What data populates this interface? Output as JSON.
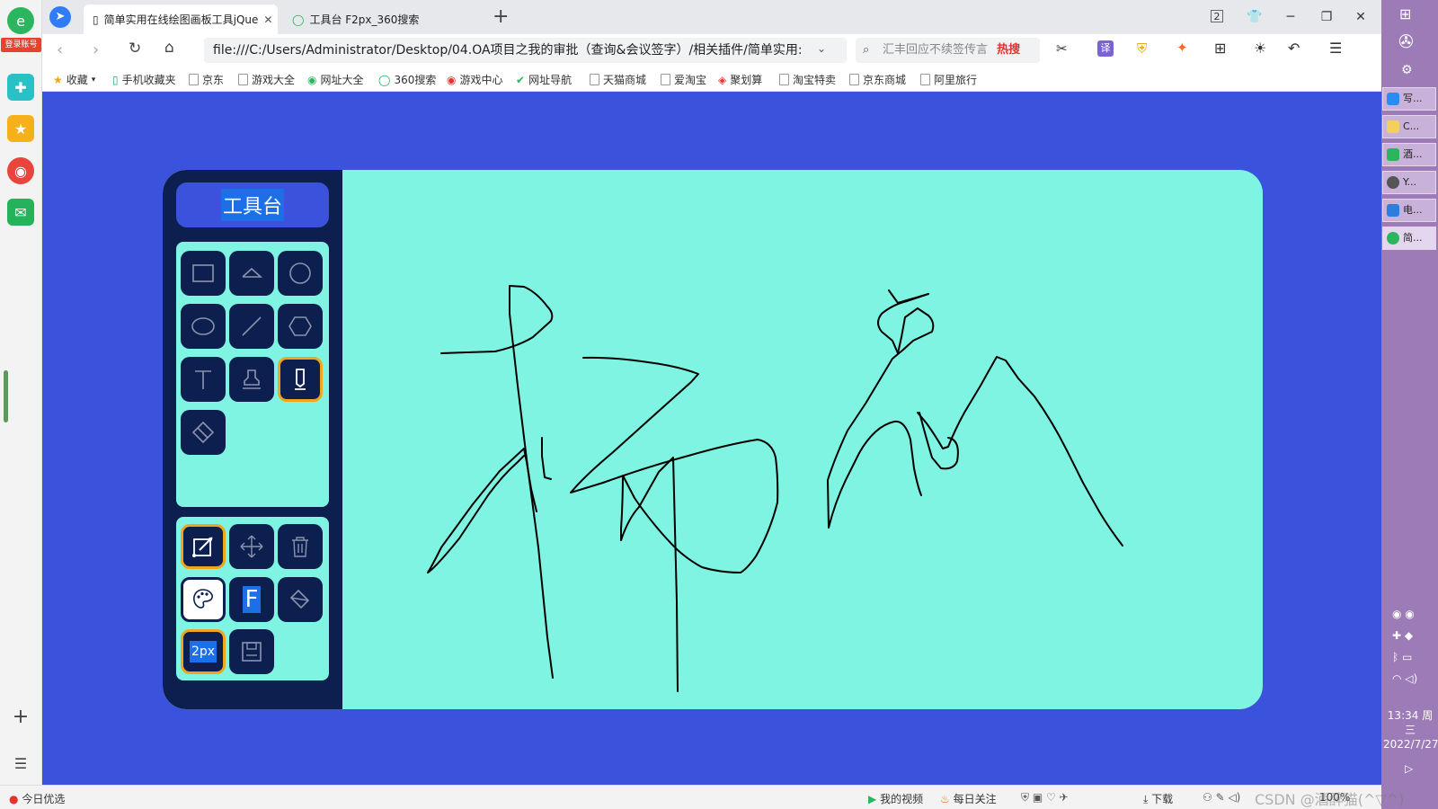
{
  "browser": {
    "tabs": [
      {
        "label": "简单实用在线绘图画板工具jQue",
        "active": true
      },
      {
        "label": "工具台 F2px_360搜索",
        "active": false
      }
    ],
    "tab_counter": "2",
    "url": "file:///C:/Users/Administrator/Desktop/04.OA项目之我的审批（查询&会议签字）/相关插件/简单实用:",
    "search_placeholder": "汇丰回应不续签传言",
    "search_hot": "热搜",
    "login_badge": "登录账号",
    "bookmarks": [
      "收藏",
      "手机收藏夹",
      "京东",
      "游戏大全",
      "网址大全",
      "360搜索",
      "游戏中心",
      "网址导航",
      "天猫商城",
      "爱淘宝",
      "聚划算",
      "淘宝特卖",
      "京东商城",
      "阿里旅行"
    ]
  },
  "status_bar": {
    "left": "今日优选",
    "items": [
      "我的视频",
      "每日关注",
      "下载"
    ],
    "zoom": "100%",
    "watermark": "CSDN @酒醉猫(^▽^)"
  },
  "taskbar": {
    "tasks": [
      "写...",
      "C...",
      "酒...",
      "Y...",
      "电...",
      "简..."
    ],
    "time": "13:34 周三",
    "date": "2022/7/27"
  },
  "toolpanel": {
    "title": "工具台",
    "shape_tools": [
      {
        "name": "rectangle",
        "icon": "rectangle-icon",
        "selected": false
      },
      {
        "name": "triangle",
        "icon": "triangle-icon",
        "selected": false
      },
      {
        "name": "circle",
        "icon": "circle-icon",
        "selected": false
      },
      {
        "name": "ellipse",
        "icon": "ellipse-icon",
        "selected": false
      },
      {
        "name": "line",
        "icon": "line-icon",
        "selected": false
      },
      {
        "name": "hexagon",
        "icon": "hexagon-icon",
        "selected": false
      },
      {
        "name": "text",
        "icon": "text-icon",
        "selected": false
      },
      {
        "name": "stamp",
        "icon": "stamp-icon",
        "selected": false
      },
      {
        "name": "pen",
        "icon": "pen-icon",
        "selected": true
      },
      {
        "name": "eraser",
        "icon": "eraser-icon",
        "selected": false
      }
    ],
    "action_tools": [
      {
        "name": "stroke-mode",
        "icon": "stroke-edit-icon",
        "selected": true
      },
      {
        "name": "move",
        "icon": "move-icon",
        "selected": false
      },
      {
        "name": "clear",
        "icon": "trash-icon",
        "selected": false
      },
      {
        "name": "color",
        "icon": "palette-icon",
        "selected": false
      },
      {
        "name": "font",
        "icon": "font-icon",
        "label": "F",
        "selected": false
      },
      {
        "name": "fill",
        "icon": "fill-bucket-icon",
        "selected": false
      },
      {
        "name": "line-width",
        "icon": "line-width-icon",
        "label": "2px",
        "selected": true
      },
      {
        "name": "save",
        "icon": "save-icon",
        "selected": false
      }
    ]
  },
  "colors": {
    "page_bg": "#3b52dc",
    "canvas_bg": "#7ff4e2",
    "panel_bg": "#0d1f4e",
    "selected_border": "#f0a51e",
    "stroke": "#000000"
  }
}
